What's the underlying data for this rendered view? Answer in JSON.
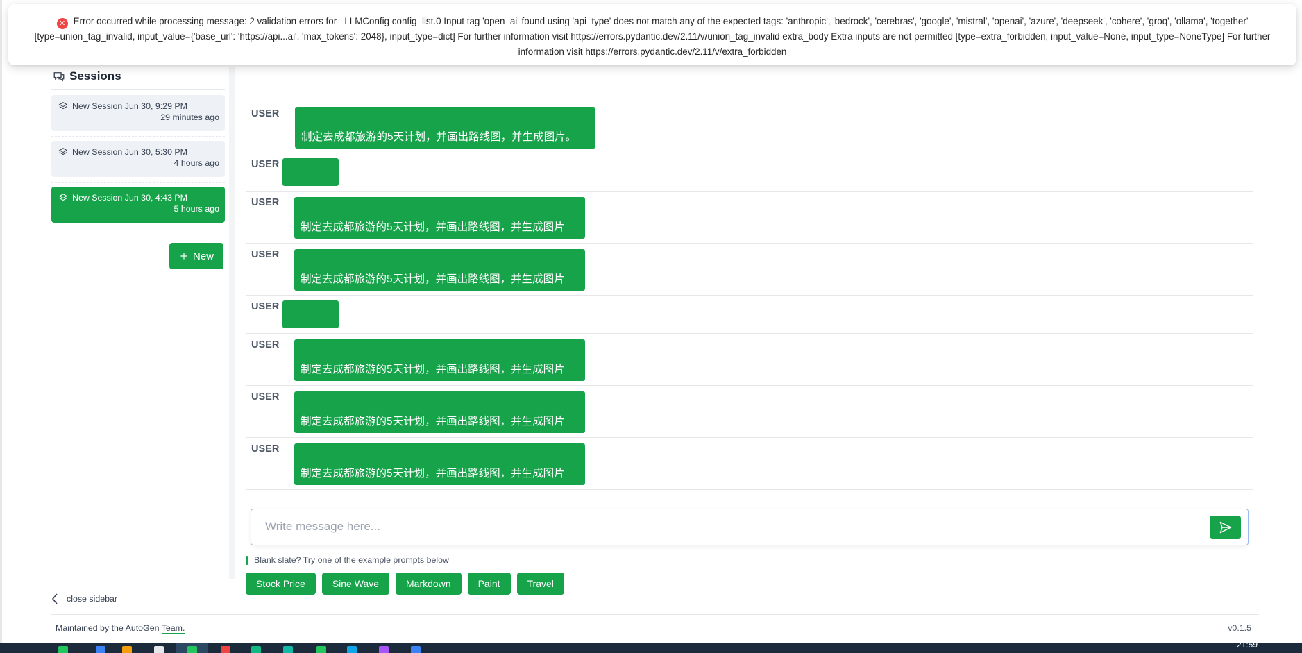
{
  "error_toast": {
    "message": "Error occurred while processing message: 2 validation errors for _LLMConfig config_list.0 Input tag 'open_ai' found using 'api_type' does not match any of the expected tags: 'anthropic', 'bedrock', 'cerebras', 'google', 'mistral', 'openai', 'azure', 'deepseek', 'cohere', 'groq', 'ollama', 'together' [type=union_tag_invalid, input_value={'base_url': 'https://api...ai', 'max_tokens': 2048}, input_type=dict] For further information visit https://errors.pydantic.dev/2.11/v/union_tag_invalid extra_body Extra inputs are not permitted [type=extra_forbidden, input_value=None, input_type=NoneType] For further information visit https://errors.pydantic.dev/2.11/v/extra_forbidden",
    "icon": "error-circle-icon",
    "color": "#ef4444"
  },
  "sidebar": {
    "title": "Sessions",
    "sessions": [
      {
        "name": "New Session Jun 30, 9:29 PM",
        "ago": "29 minutes ago",
        "active": false
      },
      {
        "name": "New Session Jun 30, 5:30 PM",
        "ago": "4 hours ago",
        "active": false
      },
      {
        "name": "New Session Jun 30, 4:43 PM",
        "ago": "5 hours ago",
        "active": true
      }
    ],
    "new_label": "New",
    "close_label": "close sidebar"
  },
  "chat": {
    "messages": [
      {
        "role": "USER",
        "text": "制定去成都旅游的5天计划，并画出路线图，并生成图片。"
      },
      {
        "role": "USER",
        "text": ""
      },
      {
        "role": "USER",
        "text": "制定去成都旅游的5天计划，并画出路线图，并生成图片"
      },
      {
        "role": "USER",
        "text": "制定去成都旅游的5天计划，并画出路线图，并生成图片"
      },
      {
        "role": "USER",
        "text": ""
      },
      {
        "role": "USER",
        "text": "制定去成都旅游的5天计划，并画出路线图，并生成图片"
      },
      {
        "role": "USER",
        "text": "制定去成都旅游的5天计划，并画出路线图，并生成图片"
      },
      {
        "role": "USER",
        "text": "制定去成都旅游的5天计划，并画出路线图，并生成图片"
      }
    ]
  },
  "composer": {
    "placeholder": "Write message here...",
    "hint": "Blank slate? Try one of the example prompts below",
    "examples": [
      "Stock Price",
      "Sine Wave",
      "Markdown",
      "Paint",
      "Travel"
    ]
  },
  "footer": {
    "maintained_prefix": "Maintained by the AutoGen",
    "team_link": "Team.",
    "version": "v0.1.5"
  },
  "taskbar": {
    "clock": "21:59"
  },
  "colors": {
    "accent": "#16a34a",
    "session_bg": "#eef2f6",
    "taskbar": "#1b2b3c"
  }
}
